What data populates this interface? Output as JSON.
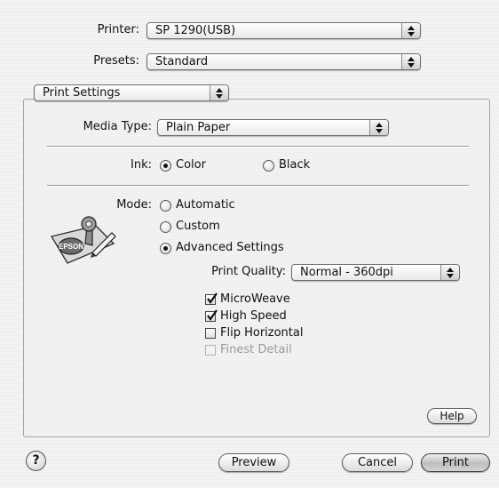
{
  "header": {
    "printer_label": "Printer:",
    "printer_value": "SP 1290(USB)",
    "presets_label": "Presets:",
    "presets_value": "Standard"
  },
  "panel_popup": {
    "value": "Print Settings"
  },
  "media": {
    "label": "Media Type:",
    "value": "Plain Paper"
  },
  "ink": {
    "label": "Ink:",
    "color_label": "Color",
    "black_label": "Black",
    "selected": "Color"
  },
  "mode": {
    "label": "Mode:",
    "automatic_label": "Automatic",
    "custom_label": "Custom",
    "advanced_label": "Advanced Settings",
    "selected": "Advanced Settings",
    "logo_text": "EPSON"
  },
  "print_quality": {
    "label": "Print Quality:",
    "value": "Normal - 360dpi"
  },
  "options": [
    {
      "label": "MicroWeave",
      "checked": true,
      "enabled": true
    },
    {
      "label": "High Speed",
      "checked": true,
      "enabled": true
    },
    {
      "label": "Flip Horizontal",
      "checked": false,
      "enabled": true
    },
    {
      "label": "Finest Detail",
      "checked": false,
      "enabled": false
    }
  ],
  "buttons": {
    "help": "Help",
    "help_question": "?",
    "preview": "Preview",
    "cancel": "Cancel",
    "print": "Print"
  },
  "icons": {
    "popup_arrows": "updown-arrows-icon",
    "checkmark": "checkmark-icon",
    "mode_illustration": "epson-mode-icon"
  }
}
